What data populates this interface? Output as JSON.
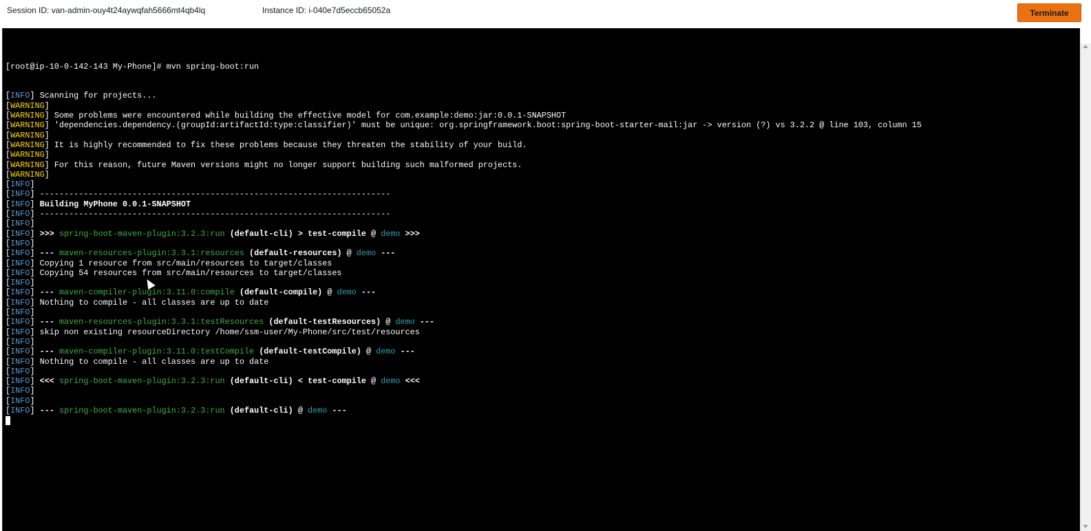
{
  "header": {
    "session_id": "Session ID: van-admin-ouy4t24aywqfah5666mt4qb4lq",
    "instance_id": "Instance ID: i-040e7d5eccb65052a",
    "terminate_label": "Terminate"
  },
  "terminal": {
    "prompt_line": "[root@ip-10-0-142-143 My-Phone]# mvn spring-boot:run",
    "tags": {
      "info": "INFO",
      "warning": "WARNING"
    },
    "lines": [
      {
        "tag": "info",
        "text": " Scanning for projects..."
      },
      {
        "tag": "warning",
        "text": ""
      },
      {
        "tag": "warning",
        "text": " Some problems were encountered while building the effective model for com.example:demo:jar:0.0.1-SNAPSHOT"
      },
      {
        "tag": "warning",
        "text": " 'dependencies.dependency.(groupId:artifactId:type:classifier)' must be unique: org.springframework.boot:spring-boot-starter-mail:jar -> version (?) vs 3.2.2 @ line 103, column 15"
      },
      {
        "tag": "warning",
        "text": ""
      },
      {
        "tag": "warning",
        "text": " It is highly recommended to fix these problems because they threaten the stability of your build."
      },
      {
        "tag": "warning",
        "text": ""
      },
      {
        "tag": "warning",
        "text": " For this reason, future Maven versions might no longer support building such malformed projects."
      },
      {
        "tag": "warning",
        "text": ""
      },
      {
        "tag": "info",
        "text": ""
      },
      {
        "tag": "info",
        "text": " ------------------------------------------------------------------------"
      },
      {
        "tag": "info",
        "segments": [
          {
            "t": " "
          },
          {
            "t": "Building MyPhone 0.0.1-SNAPSHOT",
            "s": "b"
          }
        ]
      },
      {
        "tag": "info",
        "text": " ------------------------------------------------------------------------"
      },
      {
        "tag": "info",
        "text": ""
      },
      {
        "tag": "info",
        "segments": [
          {
            "t": " "
          },
          {
            "t": ">>> ",
            "s": "b"
          },
          {
            "t": "spring-boot-maven-plugin:3.2.3:run",
            "s": "g"
          },
          {
            "t": " (default-cli)",
            "s": "b"
          },
          {
            "t": " > ",
            "s": "b"
          },
          {
            "t": "test-compile",
            "s": "b"
          },
          {
            "t": " @ ",
            "s": "b"
          },
          {
            "t": "demo",
            "s": "c"
          },
          {
            "t": " >>>",
            "s": "b"
          }
        ]
      },
      {
        "tag": "info",
        "text": ""
      },
      {
        "tag": "info",
        "segments": [
          {
            "t": " "
          },
          {
            "t": "--- ",
            "s": "b"
          },
          {
            "t": "maven-resources-plugin:3.3.1:resources",
            "s": "g"
          },
          {
            "t": " (default-resources)",
            "s": "b"
          },
          {
            "t": " @ ",
            "s": "b"
          },
          {
            "t": "demo",
            "s": "c"
          },
          {
            "t": " ---",
            "s": "b"
          }
        ]
      },
      {
        "tag": "info",
        "text": " Copying 1 resource from src/main/resources to target/classes"
      },
      {
        "tag": "info",
        "text": " Copying 54 resources from src/main/resources to target/classes"
      },
      {
        "tag": "info",
        "text": ""
      },
      {
        "tag": "info",
        "segments": [
          {
            "t": " "
          },
          {
            "t": "--- ",
            "s": "b"
          },
          {
            "t": "maven-compiler-plugin:3.11.0:compile",
            "s": "g"
          },
          {
            "t": " (default-compile)",
            "s": "b"
          },
          {
            "t": " @ ",
            "s": "b"
          },
          {
            "t": "demo",
            "s": "c"
          },
          {
            "t": " ---",
            "s": "b"
          }
        ]
      },
      {
        "tag": "info",
        "text": " Nothing to compile - all classes are up to date"
      },
      {
        "tag": "info",
        "text": ""
      },
      {
        "tag": "info",
        "segments": [
          {
            "t": " "
          },
          {
            "t": "--- ",
            "s": "b"
          },
          {
            "t": "maven-resources-plugin:3.3.1:testResources",
            "s": "g"
          },
          {
            "t": " (default-testResources)",
            "s": "b"
          },
          {
            "t": " @ ",
            "s": "b"
          },
          {
            "t": "demo",
            "s": "c"
          },
          {
            "t": " ---",
            "s": "b"
          }
        ]
      },
      {
        "tag": "info",
        "text": " skip non existing resourceDirectory /home/ssm-user/My-Phone/src/test/resources"
      },
      {
        "tag": "info",
        "text": ""
      },
      {
        "tag": "info",
        "segments": [
          {
            "t": " "
          },
          {
            "t": "--- ",
            "s": "b"
          },
          {
            "t": "maven-compiler-plugin:3.11.0:testCompile",
            "s": "g"
          },
          {
            "t": " (default-testCompile)",
            "s": "b"
          },
          {
            "t": " @ ",
            "s": "b"
          },
          {
            "t": "demo",
            "s": "c"
          },
          {
            "t": " ---",
            "s": "b"
          }
        ]
      },
      {
        "tag": "info",
        "text": " Nothing to compile - all classes are up to date"
      },
      {
        "tag": "info",
        "text": ""
      },
      {
        "tag": "info",
        "segments": [
          {
            "t": " "
          },
          {
            "t": "<<< ",
            "s": "b"
          },
          {
            "t": "spring-boot-maven-plugin:3.2.3:run",
            "s": "g"
          },
          {
            "t": " (default-cli)",
            "s": "b"
          },
          {
            "t": " < ",
            "s": "b"
          },
          {
            "t": "test-compile",
            "s": "b"
          },
          {
            "t": " @ ",
            "s": "b"
          },
          {
            "t": "demo",
            "s": "c"
          },
          {
            "t": " <<<",
            "s": "b"
          }
        ]
      },
      {
        "tag": "info",
        "text": ""
      },
      {
        "tag": "info",
        "text": ""
      },
      {
        "tag": "info",
        "segments": [
          {
            "t": " "
          },
          {
            "t": "--- ",
            "s": "b"
          },
          {
            "t": "spring-boot-maven-plugin:3.2.3:run",
            "s": "g"
          },
          {
            "t": " (default-cli)",
            "s": "b"
          },
          {
            "t": " @ ",
            "s": "b"
          },
          {
            "t": "demo",
            "s": "c"
          },
          {
            "t": " ---",
            "s": "b"
          }
        ]
      }
    ]
  },
  "colors": {
    "terminal_bg": "#000000",
    "info_tag": "#5b9bd5",
    "warning_tag": "#ffd700",
    "plugin_green": "#3cb043",
    "project_cyan": "#2aa3b0",
    "terminate_button": "#ec7211"
  }
}
